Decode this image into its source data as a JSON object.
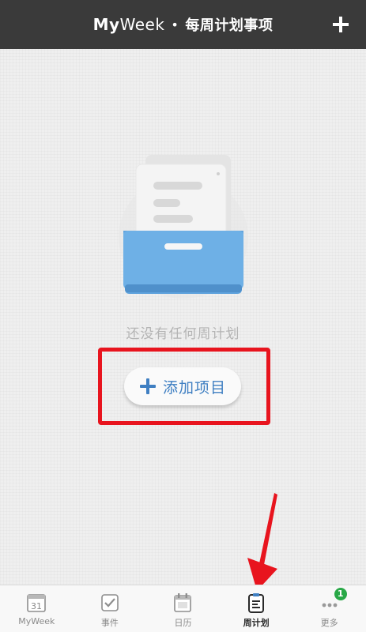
{
  "header": {
    "title_bold": "My",
    "title_regular": "Week",
    "separator": "•",
    "subtitle": "每周计划事项",
    "add_icon": "plus-icon"
  },
  "empty_state": {
    "illustration": "empty-drawer-icon",
    "message": "还没有任何周计划"
  },
  "add_item_button": {
    "icon": "plus-icon",
    "label": "添加项目"
  },
  "tabs": [
    {
      "label": "MyWeek",
      "icon": "calendar-31-icon",
      "icon_text": "31",
      "active": false
    },
    {
      "label": "事件",
      "icon": "checkbox-icon",
      "active": false
    },
    {
      "label": "日历",
      "icon": "calendar-icon",
      "active": false
    },
    {
      "label": "周计划",
      "icon": "clipboard-icon",
      "active": true
    },
    {
      "label": "更多",
      "icon": "more-dots-icon",
      "badge": "1",
      "active": false
    }
  ],
  "colors": {
    "header_bg": "#3a3a3a",
    "accent_blue": "#3f7fc2",
    "annotation_red": "#e8141e",
    "badge_green": "#29a847"
  }
}
